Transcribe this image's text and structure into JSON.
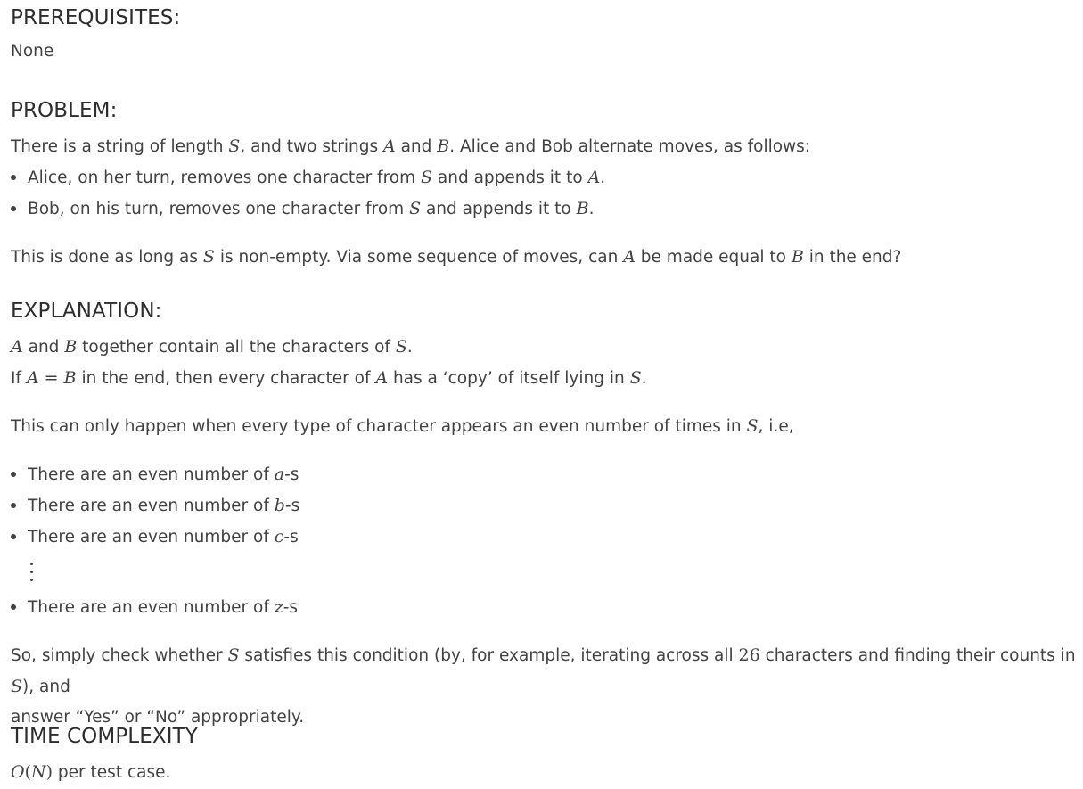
{
  "prerequisites": {
    "heading": "PREREQUISITES:",
    "text": "None"
  },
  "problem": {
    "heading": "PROBLEM:",
    "line1": {
      "t1": "There is a string of length ",
      "m1": "S",
      "t2": ", and two strings ",
      "m2": "A",
      "t3": " and ",
      "m3": "B",
      "t4": ". Alice and Bob alternate moves, as follows:"
    },
    "bullets": [
      {
        "t1": "Alice, on her turn, removes one character from ",
        "m1": "S",
        "t2": " and appends it to ",
        "m2": "A",
        "t3": "."
      },
      {
        "t1": "Bob, on his turn, removes one character from ",
        "m1": "S",
        "t2": " and appends it to ",
        "m2": "B",
        "t3": "."
      }
    ],
    "line2": {
      "t1": "This is done as long as ",
      "m1": "S",
      "t2": " is non-empty. Via some sequence of moves, can ",
      "m2": "A",
      "t3": " be made equal to ",
      "m3": "B",
      "t4": " in the end?"
    }
  },
  "explanation": {
    "heading": "EXPLANATION:",
    "line1": {
      "m1": "A",
      "t1": " and ",
      "m2": "B",
      "t2": " together contain all the characters of ",
      "m3": "S",
      "t3": "."
    },
    "line2": {
      "t1": "If ",
      "m1": "A",
      "eq": " = ",
      "m2": "B",
      "t2": " in the end, then every character of ",
      "m3": "A",
      "t3": " has a ‘copy’ of itself lying in ",
      "m4": "S",
      "t4": "."
    },
    "line3": {
      "t1": "This can only happen when every type of character appears an even number of times in ",
      "m1": "S",
      "t2": ", i.e,"
    },
    "bullets": [
      {
        "t1": "There are an even number of ",
        "m1": "a",
        "t2": "-s"
      },
      {
        "t1": "There are an even number of ",
        "m1": "b",
        "t2": "-s"
      },
      {
        "t1": "There are an even number of ",
        "m1": "c",
        "t2": "-s"
      }
    ],
    "last_bullet": {
      "t1": "There are an even number of ",
      "m1": "z",
      "t2": "-s"
    },
    "line4": {
      "t1": "So, simply check whether ",
      "m1": "S",
      "t2": " satisfies this condition (by, for example, iterating across all ",
      "n1": "26",
      "t3": " characters and finding their counts in ",
      "m2": "S",
      "t4": "), and",
      "t5": "answer “Yes” or “No” appropriately."
    }
  },
  "complexity": {
    "heading": "TIME COMPLEXITY",
    "o": "O",
    "lp": "(",
    "n": "N",
    "rp": ")",
    "text": " per test case."
  }
}
